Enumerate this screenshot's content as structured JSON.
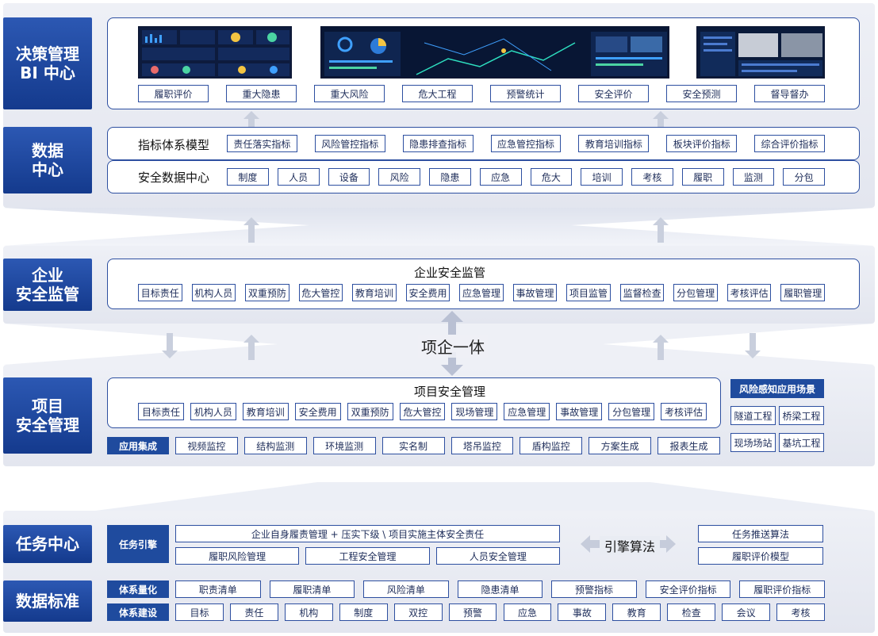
{
  "decision": {
    "side": "决策管理\nBI 中心",
    "buttons": [
      "履职评价",
      "重大隐患",
      "重大风险",
      "危大工程",
      "预警统计",
      "安全评价",
      "安全预测",
      "督导督办"
    ]
  },
  "datacenter": {
    "side": "数据\n中心",
    "index_title": "指标体系模型",
    "index_items": [
      "责任落实指标",
      "风险管控指标",
      "隐患排查指标",
      "应急管控指标",
      "教育培训指标",
      "板块评价指标",
      "综合评价指标"
    ],
    "data_title": "安全数据中心",
    "data_items": [
      "制度",
      "人员",
      "设备",
      "风险",
      "隐患",
      "应急",
      "危大",
      "培训",
      "考核",
      "履职",
      "监测",
      "分包"
    ]
  },
  "enterprise": {
    "side": "企业\n安全监管",
    "title": "企业安全监管",
    "items": [
      "目标责任",
      "机构人员",
      "双重预防",
      "危大管控",
      "教育培训",
      "安全费用",
      "应急管理",
      "事故管理",
      "项目监管",
      "监督检查",
      "分包管理",
      "考核评估",
      "履职管理"
    ]
  },
  "integration_label": "项企一体",
  "project": {
    "side": "项目\n安全管理",
    "title": "项目安全管理",
    "items": [
      "目标责任",
      "机构人员",
      "教育培训",
      "安全费用",
      "双重预防",
      "危大管控",
      "现场管理",
      "应急管理",
      "事故管理",
      "分包管理",
      "考核评估"
    ],
    "risk_title": "风险感知应用场景",
    "risk_items": [
      "隧道工程",
      "桥梁工程",
      "现场场站",
      "基坑工程"
    ],
    "app_label": "应用集成",
    "app_items": [
      "视频监控",
      "结构监测",
      "环境监测",
      "实名制",
      "塔吊监控",
      "盾构监控",
      "方案生成",
      "报表生成"
    ]
  },
  "task": {
    "side": "任务中心",
    "engine_label": "任务引擎",
    "row1": "企业自身履责管理 + 压实下级 \\ 项目实施主体安全责任",
    "row2": [
      "履职风险管理",
      "工程安全管理",
      "人员安全管理"
    ],
    "algo_label": "引擎算法",
    "algo_items": [
      "任务推送算法",
      "履职评价模型"
    ]
  },
  "standard": {
    "side": "数据标准",
    "quant_label": "体系量化",
    "quant_items": [
      "职责清单",
      "履职清单",
      "风险清单",
      "隐患清单",
      "预警指标",
      "安全评价指标",
      "履职评价指标"
    ],
    "build_label": "体系建设",
    "build_items": [
      "目标",
      "责任",
      "机构",
      "制度",
      "双控",
      "预警",
      "应急",
      "事故",
      "教育",
      "检查",
      "会议",
      "考核"
    ]
  },
  "colors": {
    "primary": "#1f4b9e",
    "border": "#2d4fa0",
    "band": "#e8ebf3"
  }
}
